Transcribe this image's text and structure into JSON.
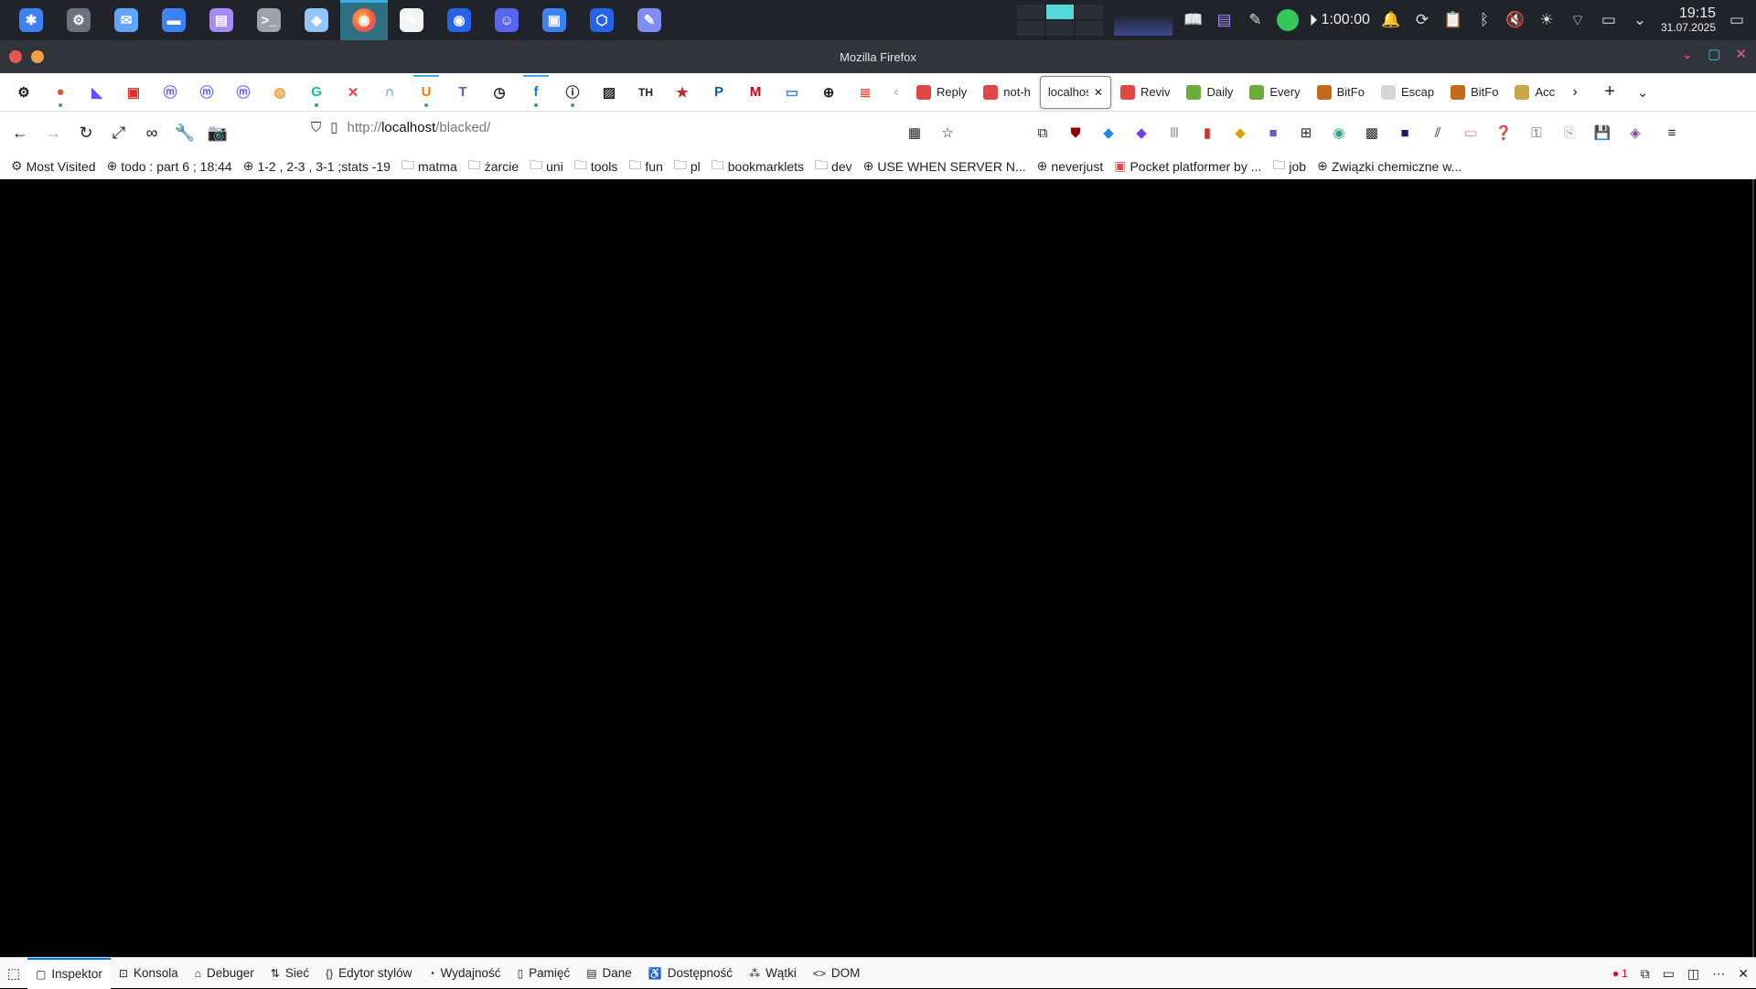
{
  "taskbar": {
    "apps": [
      {
        "icon": "app-launcher-icon",
        "color": "#3b82f6"
      },
      {
        "icon": "settings-gear-icon",
        "color": "#6b7280"
      },
      {
        "icon": "mail-icon",
        "color": "#60a5fa"
      },
      {
        "icon": "folder-icon",
        "color": "#3b82f6"
      },
      {
        "icon": "notes-app-icon",
        "color": "#a78bfa"
      },
      {
        "icon": "terminal-icon",
        "color": "#9ca3af"
      },
      {
        "icon": "vpn-icon",
        "color": "#93c5fd"
      },
      {
        "icon": "firefox-icon",
        "color": "#f97316",
        "active": true
      },
      {
        "icon": "inkscape-icon",
        "color": "#f3f4f6"
      },
      {
        "icon": "thunderbird-icon",
        "color": "#2563eb"
      },
      {
        "icon": "discord-icon",
        "color": "#5865f2"
      },
      {
        "icon": "chat-icon",
        "color": "#3b82f6"
      },
      {
        "icon": "cube-app-icon",
        "color": "#2563eb"
      },
      {
        "icon": "text-editor-icon",
        "color": "#818cf8"
      }
    ],
    "timer": "1:00:00",
    "clock_time": "19:15",
    "clock_date": "31.07.2025"
  },
  "window": {
    "title": "Mozilla Firefox"
  },
  "tabs": {
    "pinned_icons": [
      "settings-icon",
      "duckduckgo-icon",
      "proton-mail-icon",
      "pdf-icon",
      "mastodon-icon",
      "mastodon-icon",
      "mastodon-icon",
      "chrome-icon",
      "grammarly-icon",
      "muted-app-icon",
      "arc-icon",
      "uwork-icon",
      "teams-icon",
      "clock-icon",
      "facebook-icon",
      "info-icon",
      "image-edit-icon",
      "th-text-icon",
      "star-red-icon",
      "pinterest-icon",
      "mega-icon",
      "tv-icon",
      "globe-icon",
      "todoist-icon"
    ],
    "th_label": "TH",
    "open": [
      {
        "label": "Reply",
        "icon_color": "#e04848",
        "selected": false
      },
      {
        "label": "not-h",
        "icon_color": "#e04848",
        "selected": false
      },
      {
        "label": "localhost",
        "icon_color": "",
        "selected": true
      },
      {
        "label": "Reviv",
        "icon_color": "#e04848",
        "selected": false
      },
      {
        "label": "Daily",
        "icon_color": "#6aab3c",
        "selected": false
      },
      {
        "label": "Every",
        "icon_color": "#6aab3c",
        "selected": false
      },
      {
        "label": "BitFo",
        "icon_color": "#c26b1b",
        "selected": false
      },
      {
        "label": "Escap",
        "icon_color": "#d6d6d6",
        "selected": false
      },
      {
        "label": "BitFo",
        "icon_color": "#c26b1b",
        "selected": false
      },
      {
        "label": "Acc",
        "icon_color": "#c8a64a",
        "selected": false
      }
    ]
  },
  "navbar": {
    "url_prefix": "http://",
    "url_host": "localhost",
    "url_path": "/blacked/"
  },
  "bookmarks": [
    {
      "icon": "gear-icon",
      "label": "Most Visited"
    },
    {
      "icon": "globe-icon",
      "label": "todo : part 6 ; 18:44"
    },
    {
      "icon": "globe-icon",
      "label": "1-2 , 2-3 , 3-1 ;stats -19"
    },
    {
      "icon": "folder-icon",
      "label": "matma"
    },
    {
      "icon": "folder-icon",
      "label": "żarcie"
    },
    {
      "icon": "folder-icon",
      "label": "uni"
    },
    {
      "icon": "folder-icon",
      "label": "tools"
    },
    {
      "icon": "folder-icon",
      "label": "fun"
    },
    {
      "icon": "folder-icon",
      "label": "pl"
    },
    {
      "icon": "folder-icon",
      "label": "bookmarklets"
    },
    {
      "icon": "folder-icon",
      "label": "dev"
    },
    {
      "icon": "globe-icon",
      "label": "USE WHEN SERVER N..."
    },
    {
      "icon": "globe-icon",
      "label": "neverjust"
    },
    {
      "icon": "game-icon",
      "label": "Pocket platformer by ..."
    },
    {
      "icon": "folder-icon",
      "label": "job"
    },
    {
      "icon": "globe-icon",
      "label": "Związki chemiczne w..."
    }
  ],
  "devtools": {
    "tabs": [
      {
        "label": "Inspektor",
        "icon": "inspector-icon",
        "active": true
      },
      {
        "label": "Konsola",
        "icon": "console-icon",
        "active": false
      },
      {
        "label": "Debuger",
        "icon": "debugger-icon",
        "active": false
      },
      {
        "label": "Sieć",
        "icon": "network-icon",
        "active": false
      },
      {
        "label": "Edytor stylów",
        "icon": "style-editor-icon",
        "active": false
      },
      {
        "label": "Wydajność",
        "icon": "performance-icon",
        "active": false
      },
      {
        "label": "Pamięć",
        "icon": "memory-icon",
        "active": false
      },
      {
        "label": "Dane",
        "icon": "storage-icon",
        "active": false
      },
      {
        "label": "Dostępność",
        "icon": "accessibility-icon",
        "active": false
      },
      {
        "label": "Wątki",
        "icon": "workers-icon",
        "active": false
      },
      {
        "label": "DOM",
        "icon": "dom-icon",
        "active": false
      }
    ],
    "error_count": "1"
  }
}
